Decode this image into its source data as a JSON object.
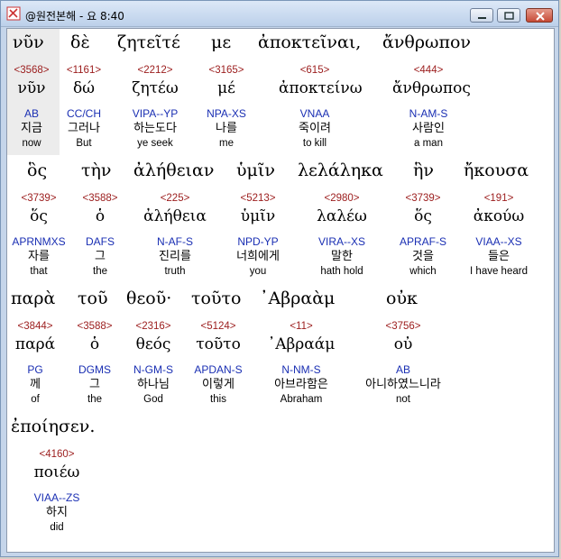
{
  "window": {
    "title": "@원전본해 - 요 8:40"
  },
  "rows": [
    {
      "greek": [
        "νῦν",
        "δὲ",
        "ζητεῖτέ",
        "με",
        "ἀποκτεῖναι,",
        "ἄνθρωπον"
      ],
      "words": [
        {
          "strong": "<3568>",
          "lemma": "νῦν",
          "parse": "AB",
          "korean": "지금",
          "english": "now"
        },
        {
          "strong": "<1161>",
          "lemma": "δώ",
          "parse": "CC/CH",
          "korean": "그러나",
          "english": "But"
        },
        {
          "strong": "<2212>",
          "lemma": "ζητέω",
          "parse": "VIPA--YP",
          "korean": "하는도다",
          "english": "ye seek"
        },
        {
          "strong": "<3165>",
          "lemma": "μέ",
          "parse": "NPA-XS",
          "korean": "나를",
          "english": "me"
        },
        {
          "strong": "<615>",
          "lemma": "ἀποκτείνω",
          "parse": "VNAA",
          "korean": "죽이려",
          "english": "to kill"
        },
        {
          "strong": "<444>",
          "lemma": "ἄνθρωπος",
          "parse": "N-AM-S",
          "korean": "사람인",
          "english": "a man"
        }
      ]
    },
    {
      "greek": [
        "ὃς",
        "τὴν",
        "ἀλήθειαν",
        "ὑμῖν",
        "λελάληκα",
        "ἣν",
        "ἤκουσα"
      ],
      "words": [
        {
          "strong": "<3739>",
          "lemma": "ὅς",
          "parse": "APRNMXS",
          "korean": "자를",
          "english": "that"
        },
        {
          "strong": "<3588>",
          "lemma": "ὁ",
          "parse": "DAFS",
          "korean": "그",
          "english": "the"
        },
        {
          "strong": "<225>",
          "lemma": "ἀλήθεια",
          "parse": "N-AF-S",
          "korean": "진리를",
          "english": "truth"
        },
        {
          "strong": "<5213>",
          "lemma": "ὑμῖν",
          "parse": "NPD-YP",
          "korean": "너희에게",
          "english": "you"
        },
        {
          "strong": "<2980>",
          "lemma": "λαλέω",
          "parse": "VIRA--XS",
          "korean": "말한",
          "english": "hath hold"
        },
        {
          "strong": "<3739>",
          "lemma": "ὅς",
          "parse": "APRAF-S",
          "korean": "것을",
          "english": "which"
        },
        {
          "strong": "<191>",
          "lemma": "ἀκούω",
          "parse": "VIAA--XS",
          "korean": "들은",
          "english": "I have heard"
        }
      ]
    },
    {
      "greek": [
        "παρὰ",
        "τοῦ",
        "θεοῦ·",
        "τοῦτο",
        "᾿Αβραὰμ",
        "οὐκ"
      ],
      "words": [
        {
          "strong": "<3844>",
          "lemma": "παρά",
          "parse": "PG",
          "korean": "께",
          "english": "of"
        },
        {
          "strong": "<3588>",
          "lemma": "ὁ",
          "parse": "DGMS",
          "korean": "그",
          "english": "the"
        },
        {
          "strong": "<2316>",
          "lemma": "θεός",
          "parse": "N-GM-S",
          "korean": "하나님",
          "english": "God"
        },
        {
          "strong": "<5124>",
          "lemma": "τοῦτο",
          "parse": "APDAN-S",
          "korean": "이렇게",
          "english": "this"
        },
        {
          "strong": "<11>",
          "lemma": "᾿Αβραάμ",
          "parse": "N-NM-S",
          "korean": "아브라함은",
          "english": "Abraham"
        },
        {
          "strong": "<3756>",
          "lemma": "οὐ",
          "parse": "AB",
          "korean": "아니하였느니라",
          "english": "not"
        }
      ]
    },
    {
      "greek": [
        "ἐποίησεν."
      ],
      "words": [
        {
          "strong": "<4160>",
          "lemma": "ποιέω",
          "parse": "VIAA--ZS",
          "korean": "하지",
          "english": "did"
        }
      ]
    }
  ]
}
